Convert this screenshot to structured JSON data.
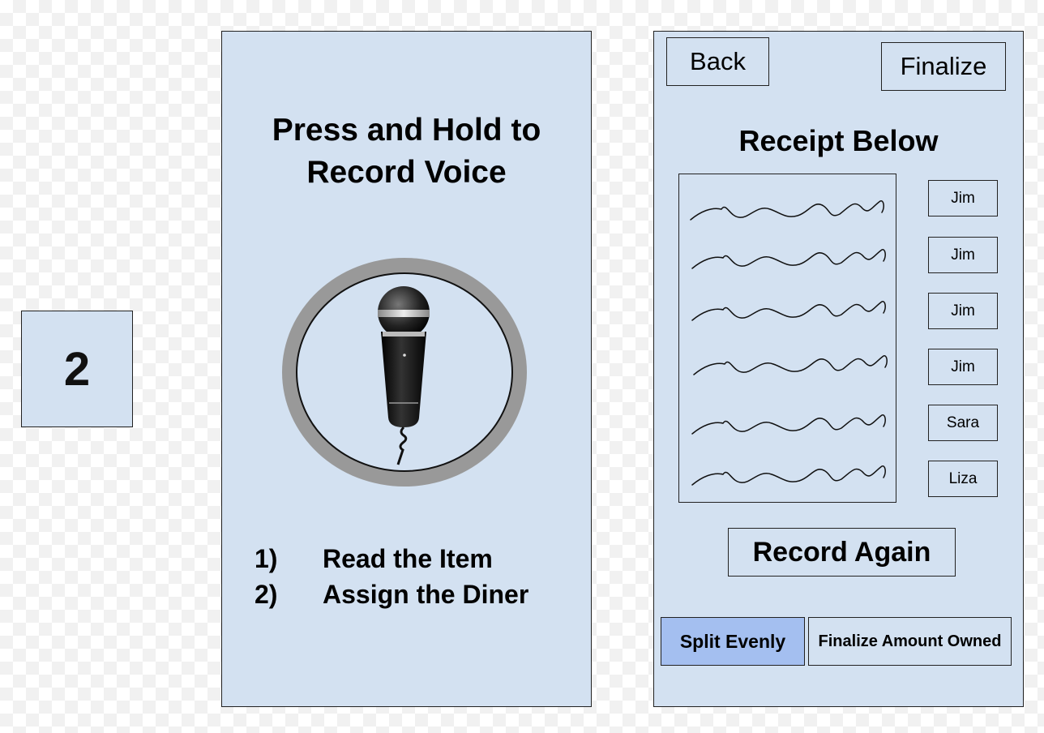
{
  "step_number": "2",
  "record_screen": {
    "title_line1": "Press and Hold to",
    "title_line2": "Record Voice",
    "instructions": [
      {
        "num": "1)",
        "text": "Read the Item"
      },
      {
        "num": "2)",
        "text": "Assign the Diner"
      }
    ]
  },
  "receipt_screen": {
    "back_label": "Back",
    "finalize_label": "Finalize",
    "heading": "Receipt Below",
    "diners": [
      "Jim",
      "Jim",
      "Jim",
      "Jim",
      "Sara",
      "Liza"
    ],
    "record_again_label": "Record Again",
    "split_evenly_label": "Split Evenly",
    "finalize_amount_label": "Finalize Amount Owned"
  },
  "colors": {
    "panel_background": "#d3e1f1",
    "split_button_highlight": "#a4bff0",
    "border": "#222222"
  },
  "icons": [
    "microphone-icon"
  ]
}
